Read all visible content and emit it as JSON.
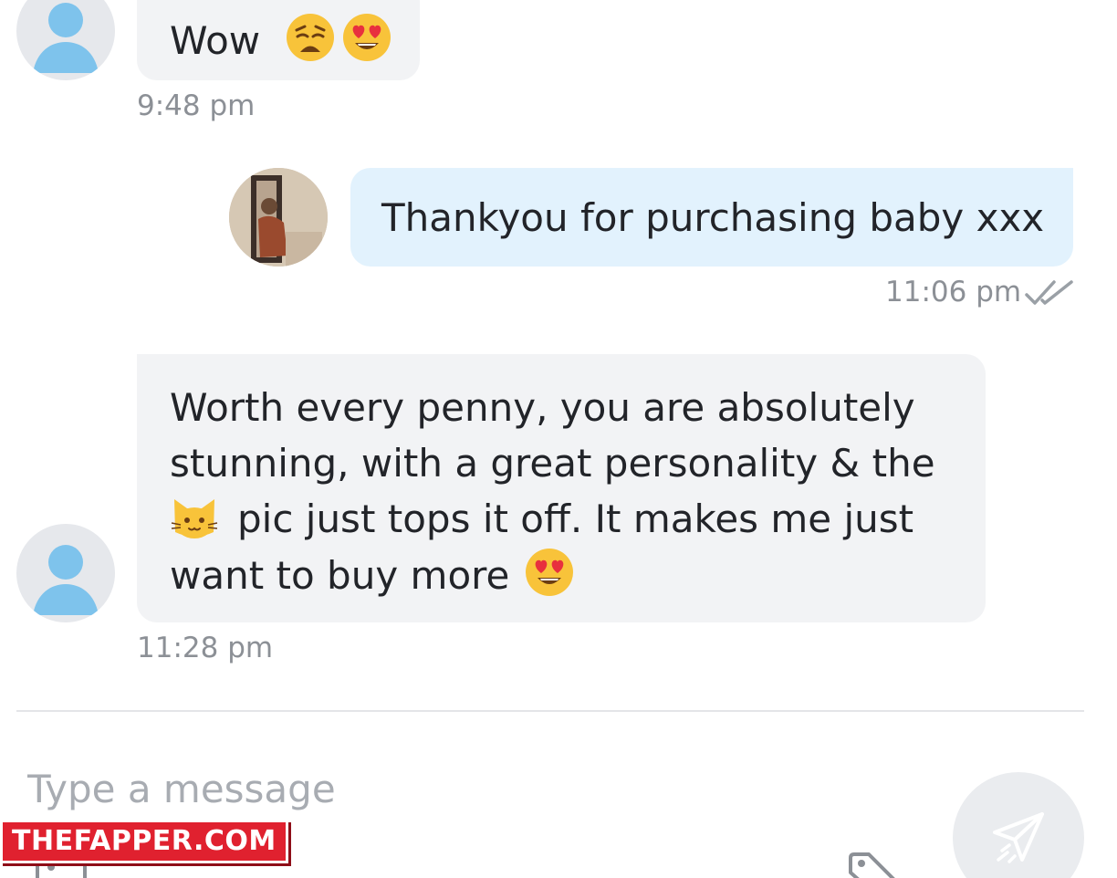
{
  "conversation": {
    "messages": [
      {
        "direction": "received",
        "text": "Wow",
        "emojis": [
          "weary-face",
          "heart-eyes-face"
        ],
        "time": "9:48 pm"
      },
      {
        "direction": "sent",
        "text": "Thankyou for purchasing baby xxx",
        "time": "11:06 pm",
        "status": "read"
      },
      {
        "direction": "received",
        "lines": [
          "Worth every penny, you are absolutely",
          "stunning, with a great personality & the",
          "pic just tops it off. It makes me just",
          "want to buy more"
        ],
        "emojis": [
          "cat-face",
          "heart-eyes-face"
        ],
        "time": "11:28 pm"
      }
    ]
  },
  "composer": {
    "placeholder": "Type a message",
    "value": ""
  },
  "watermark": {
    "text": "THEFAPPER.COM"
  },
  "colors": {
    "received_bubble": "#f2f3f5",
    "sent_bubble": "#e2f2fd",
    "timestamp": "#8c9096",
    "default_avatar": "#7ec3ec",
    "watermark": "#e0212f"
  },
  "icons": {
    "default_avatar": "user-silhouette-icon",
    "read_receipt": "double-check-icon",
    "send": "paper-plane-icon",
    "attach": "image-attach-icon",
    "price_tag": "price-tag-icon"
  }
}
